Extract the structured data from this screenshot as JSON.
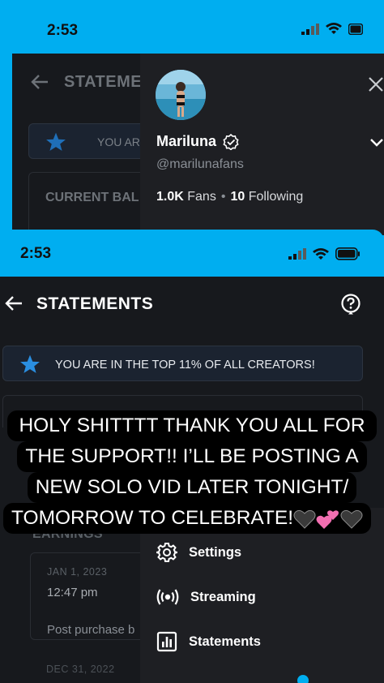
{
  "back_screen": {
    "status_time": "2:53",
    "title": "STATEMENTS",
    "banner_text": "YOU ARE I",
    "card_label": "CURRENT BAL",
    "profile": {
      "name": "Mariluna",
      "handle": "@marilunafans",
      "fans_count": "1.0K",
      "fans_label": "Fans",
      "following_count": "10",
      "following_label": "Following"
    }
  },
  "front_screen": {
    "status_time": "2:53",
    "title": "STATEMENTS",
    "banner_text": "YOU ARE IN THE TOP 11% OF ALL CREATORS!",
    "earnings_label": "EARNINGS",
    "earning_item": {
      "date": "JAN 1, 2023",
      "time": "12:47 pm",
      "description": "Post purchase b"
    },
    "next_date": "DEC 31, 2022",
    "menu": [
      {
        "label": "Settings",
        "icon": "gear-icon"
      },
      {
        "label": "Streaming",
        "icon": "streaming-icon"
      },
      {
        "label": "Statements",
        "icon": "bar-chart-icon"
      }
    ]
  },
  "caption": {
    "line1": "HOLY SHITTTT THANK YOU ALL FOR",
    "line2": "THE SUPPORT!! I’LL BE POSTING A",
    "line3": "NEW SOLO VID LATER TONIGHT/",
    "line4": "TOMORROW TO CELEBRATE!",
    "emojis": [
      "black-heart-icon",
      "two-hearts-icon",
      "black-heart-icon"
    ]
  },
  "colors": {
    "accent": "#00aef0",
    "app_bg": "#17191d",
    "drawer_bg": "#1e1f23",
    "banner_bg": "#1b2330"
  }
}
